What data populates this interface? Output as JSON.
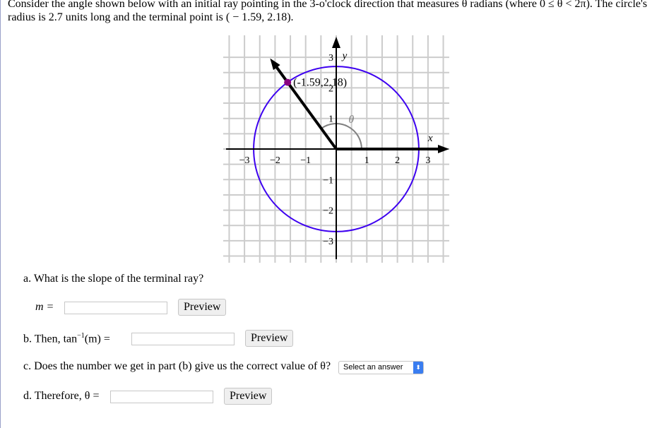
{
  "intro": {
    "line1": "Consider the angle shown below with an initial ray pointing in the 3-o'clock direction that measures θ radians (where 0 ≤ θ < 2π). The circle's",
    "line2": "radius is 2.7 units long and the terminal point is ( − 1.59, 2.18)."
  },
  "graph": {
    "x_label": "x",
    "y_label": "y",
    "x_ticks": [
      "−3",
      "−2",
      "−1",
      "1",
      "2",
      "3"
    ],
    "y_ticks": [
      "3",
      "2",
      "1",
      "−1",
      "−2",
      "−3"
    ],
    "point_label": "(-1.59,2.18)",
    "angle_label": "θ",
    "radius": 2.7,
    "point": [
      -1.59,
      2.18
    ],
    "colors": {
      "circle": "#3d00f0",
      "point": "#8a0080",
      "arc": "#808080",
      "grid": "#cccccc"
    }
  },
  "questions": {
    "a": {
      "text": "a. What is the slope of the terminal ray?",
      "var_label": "m =",
      "value": "",
      "preview": "Preview"
    },
    "b": {
      "prefix": "b. Then, tan",
      "sup": "−1",
      "suffix": "(m) =",
      "value": "",
      "preview": "Preview"
    },
    "c": {
      "text": "c. Does the number we get in part (b) give us the correct value of θ?",
      "select": "Select an answer"
    },
    "d": {
      "text": "d. Therefore, θ =",
      "value": "",
      "preview": "Preview"
    }
  }
}
